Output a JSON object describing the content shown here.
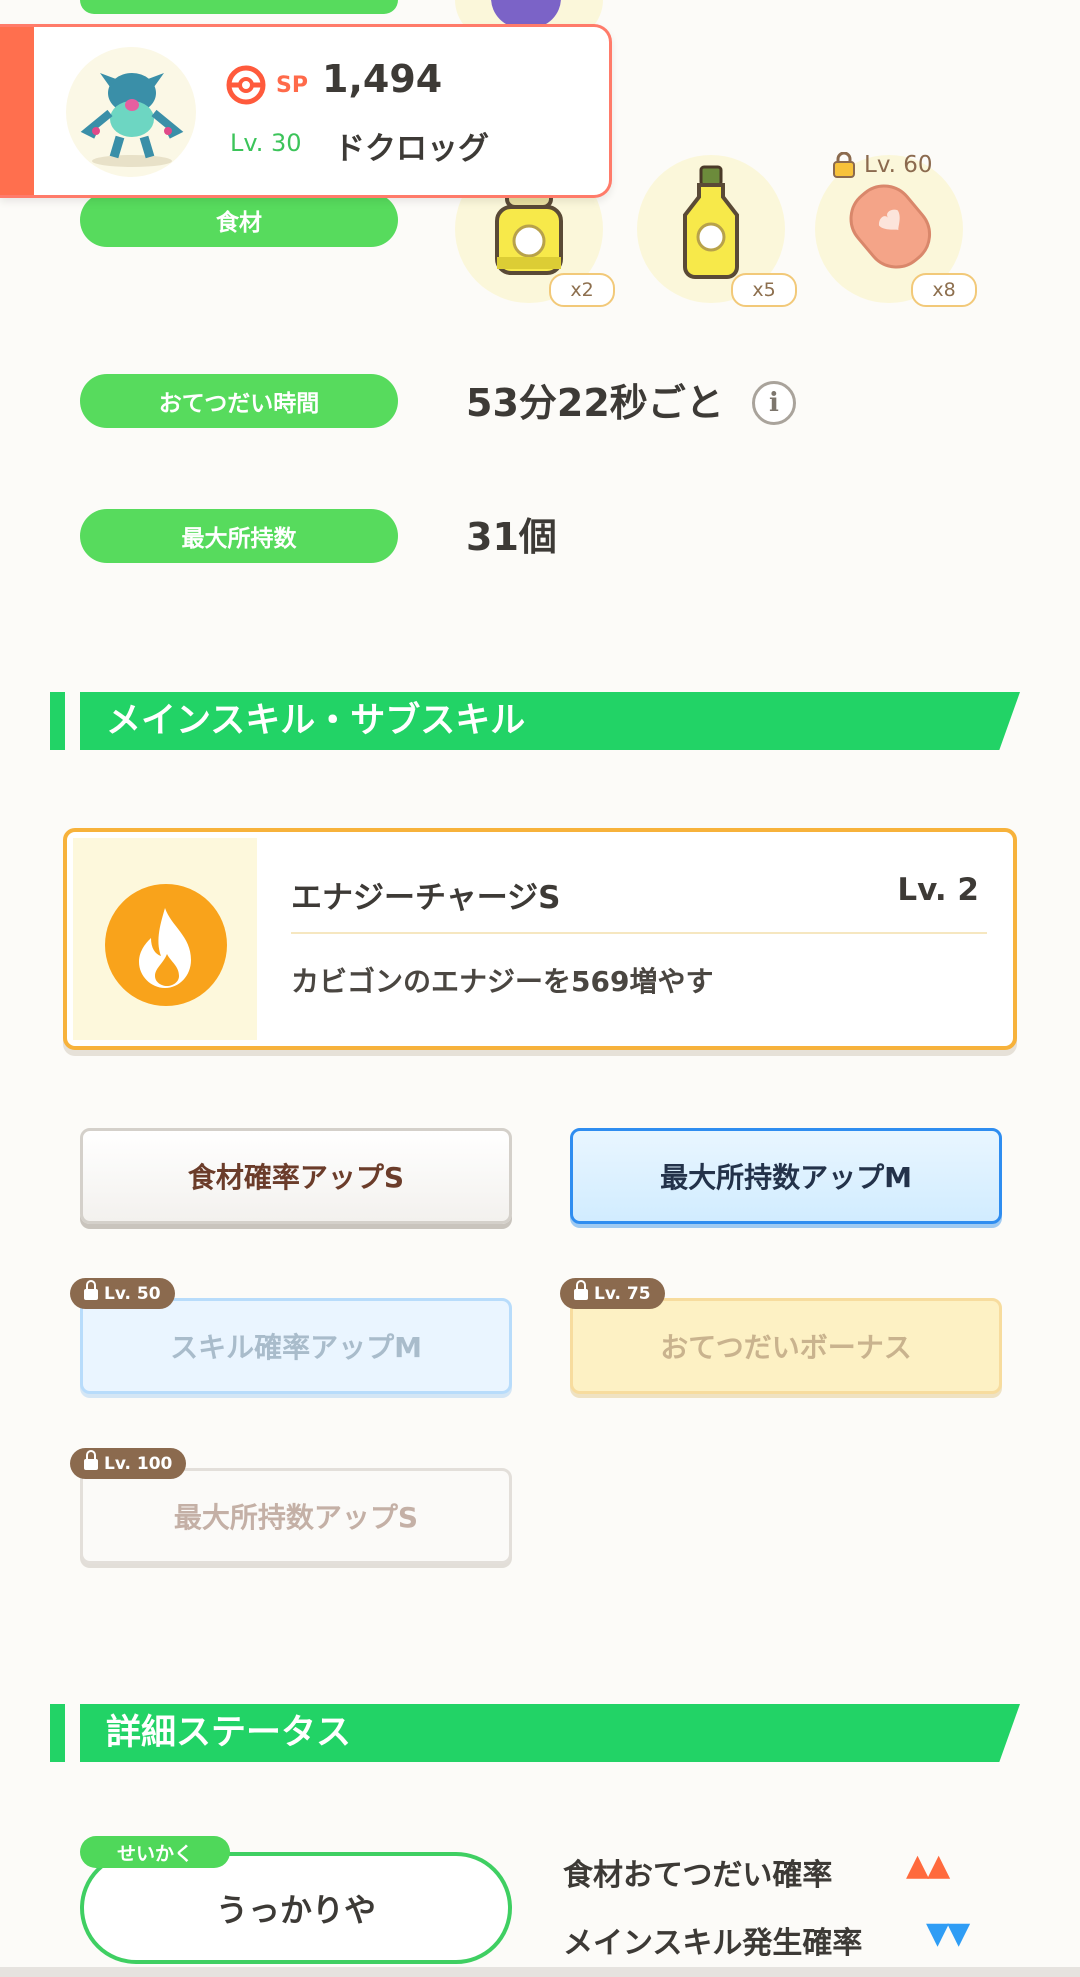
{
  "header_card": {
    "sp_label": "SP",
    "sp_value": "1,494",
    "level": "Lv. 30",
    "name": "ドクロッグ"
  },
  "ingredients": {
    "label": "食材",
    "items": [
      {
        "qty": "x2",
        "icon": "oil-bottle-icon"
      },
      {
        "qty": "x5",
        "icon": "oil-bottle-icon"
      },
      {
        "qty": "x8",
        "icon": "sausage-icon",
        "lock_level": "Lv. 60"
      }
    ]
  },
  "help_time": {
    "label": "おてつだい時間",
    "value": "53分22秒ごと"
  },
  "max_carry": {
    "label": "最大所持数",
    "value": "31個"
  },
  "skills_section": {
    "title": "メインスキル・サブスキル",
    "main_skill": {
      "name": "エナジーチャージS",
      "level": "Lv. 2",
      "description": "カビゴンのエナジーを569増やす",
      "icon": "flame-icon"
    },
    "sub_skills": [
      {
        "label": "食材確率アップS",
        "state": "unlocked"
      },
      {
        "label": "最大所持数アップM",
        "state": "unlocked"
      },
      {
        "label": "スキル確率アップM",
        "state": "locked",
        "lock_level": "Lv. 50"
      },
      {
        "label": "おてつだいボーナス",
        "state": "locked",
        "lock_level": "Lv. 75"
      },
      {
        "label": "最大所持数アップS",
        "state": "locked",
        "lock_level": "Lv. 100"
      }
    ]
  },
  "detail_section": {
    "title": "詳細ステータス",
    "nature_tag": "せいかく",
    "nature_value": "うっかりや",
    "effects": [
      {
        "label": "食材おてつだい確率",
        "indicator": "▲▲",
        "color": "#ff6a3d"
      },
      {
        "label": "メインスキル発生確率",
        "indicator": "▼▼",
        "color": "#2f9df5"
      }
    ]
  },
  "colors": {
    "accent_green": "#22d366",
    "pill_green": "#57db5d",
    "skill_border": "#f7b23b",
    "card_accent": "#ff6f4e"
  }
}
